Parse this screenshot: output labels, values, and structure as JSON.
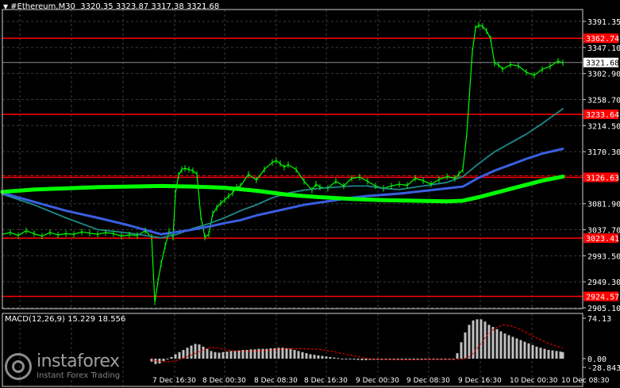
{
  "header": {
    "symbol": "#Ethereum,M30",
    "ohlc": "3320.35 3323.87 3317.38 3321.68"
  },
  "macd_header": "MACD(12,26,9) 15.229 18.556",
  "logo": {
    "name": "instaforex",
    "tagline": "Instant Forex Trading"
  },
  "colors": {
    "background": "#000000",
    "grid": "#3c3c3c",
    "axis": "#ffffff",
    "candles": "#00ff00",
    "level_lines": "#ff0000",
    "ma_fast": "#1d8a8a",
    "ma_mid": "#3a5fe0",
    "ma_slow": "#00ff00",
    "macd_hist": "#c0c0c0",
    "macd_signal": "#ff0000"
  },
  "chart_data": {
    "type": "line",
    "title": "#Ethereum,M30",
    "price_axis": {
      "min": 2905.1,
      "max": 3391.35,
      "ticks": [
        3391.35,
        3347.1,
        3302.9,
        3258.7,
        3214.5,
        3170.3,
        3081.9,
        3037.7,
        2993.5,
        2949.3,
        2905.1
      ]
    },
    "time_labels": [
      "7 Dec 16:30",
      "8 Dec 00:30",
      "8 Dec 08:30",
      "8 Dec 16:30",
      "9 Dec 00:30",
      "9 Dec 08:30",
      "9 Dec 16:30",
      "10 Dec 00:30",
      "10 Dec 08:30"
    ],
    "levels": [
      {
        "value": 3362.74,
        "label": "3362.74"
      },
      {
        "value": 3233.64,
        "label": "3233.64"
      },
      {
        "value": 3126.63,
        "label": "3126.63"
      },
      {
        "value": 3023.41,
        "label": "3023.41"
      },
      {
        "value": 2924.57,
        "label": "2924.57"
      }
    ],
    "current_price": {
      "value": 3321.68,
      "label": "3321.68"
    },
    "series": [
      {
        "name": "price",
        "color": "#00ff00",
        "x": [
          0,
          10,
          20,
          30,
          40,
          50,
          60,
          70,
          80,
          90,
          100,
          110,
          120,
          130,
          140,
          150,
          160,
          170,
          180,
          188,
          192,
          196,
          200,
          205,
          210,
          215,
          218,
          222,
          226,
          230,
          235,
          240,
          245,
          250,
          255,
          260,
          265,
          270,
          275,
          280,
          285,
          290,
          295,
          300,
          310,
          320,
          330,
          340,
          345,
          350,
          355,
          360,
          370,
          380,
          390,
          395,
          400,
          410,
          420,
          430,
          440,
          450,
          460,
          470,
          480,
          490,
          500,
          510,
          520,
          530,
          540,
          550,
          560,
          570,
          575,
          580,
          585,
          588,
          592,
          596,
          600,
          605,
          610,
          615,
          620,
          625,
          630,
          640,
          650,
          660,
          670,
          680,
          690,
          700,
          706
        ],
        "y": [
          3030,
          3033,
          3028,
          3036,
          3031,
          3027,
          3033,
          3029,
          3031,
          3030,
          3034,
          3032,
          3030,
          3033,
          3031,
          3027,
          3029,
          3028,
          3036,
          3025,
          2915,
          2950,
          2980,
          3010,
          3035,
          3025,
          3100,
          3130,
          3140,
          3142,
          3140,
          3138,
          3132,
          3060,
          3025,
          3030,
          3065,
          3075,
          3083,
          3088,
          3095,
          3100,
          3110,
          3112,
          3132,
          3122,
          3140,
          3152,
          3155,
          3150,
          3144,
          3148,
          3140,
          3120,
          3105,
          3115,
          3110,
          3108,
          3120,
          3112,
          3125,
          3127,
          3120,
          3112,
          3108,
          3112,
          3115,
          3113,
          3125,
          3121,
          3115,
          3123,
          3128,
          3125,
          3132,
          3140,
          3200,
          3260,
          3340,
          3380,
          3385,
          3383,
          3375,
          3362,
          3320,
          3318,
          3310,
          3318,
          3316,
          3305,
          3300,
          3310,
          3315,
          3324,
          3321
        ]
      },
      {
        "name": "fast_ma",
        "color": "#1d8a8a",
        "x": [
          0,
          40,
          80,
          120,
          160,
          200,
          220,
          240,
          260,
          280,
          300,
          320,
          340,
          360,
          380,
          400,
          420,
          440,
          460,
          480,
          500,
          520,
          540,
          560,
          580,
          600,
          620,
          640,
          660,
          680,
          706
        ],
        "y": [
          3098,
          3080,
          3058,
          3038,
          3032,
          3024,
          3030,
          3040,
          3048,
          3058,
          3070,
          3080,
          3092,
          3100,
          3105,
          3108,
          3110,
          3112,
          3112,
          3108,
          3106,
          3110,
          3114,
          3118,
          3128,
          3150,
          3170,
          3185,
          3200,
          3218,
          3243
        ]
      },
      {
        "name": "mid_ma",
        "color": "#3a5fe0",
        "x": [
          0,
          40,
          80,
          120,
          160,
          200,
          220,
          240,
          260,
          280,
          300,
          320,
          340,
          360,
          380,
          400,
          420,
          440,
          460,
          480,
          500,
          520,
          540,
          560,
          580,
          600,
          620,
          640,
          660,
          680,
          706
        ],
        "y": [
          3100,
          3085,
          3070,
          3058,
          3045,
          3030,
          3034,
          3038,
          3043,
          3049,
          3054,
          3062,
          3068,
          3074,
          3080,
          3084,
          3088,
          3092,
          3095,
          3097,
          3099,
          3102,
          3105,
          3108,
          3111,
          3126,
          3138,
          3148,
          3158,
          3167,
          3175
        ]
      },
      {
        "name": "slow_ma",
        "color": "#00ff00",
        "x": [
          0,
          40,
          80,
          120,
          160,
          200,
          240,
          280,
          320,
          360,
          400,
          440,
          480,
          520,
          560,
          580,
          600,
          620,
          640,
          660,
          680,
          706
        ],
        "y": [
          3102,
          3106,
          3108,
          3110,
          3111,
          3112,
          3111,
          3109,
          3104,
          3097,
          3093,
          3090,
          3088,
          3087,
          3086,
          3087,
          3093,
          3100,
          3107,
          3114,
          3121,
          3128
        ]
      }
    ],
    "macd": {
      "axis": {
        "max": 74.13,
        "zero": 0.0,
        "min": -28.843,
        "ticks": [
          74.13,
          0.0,
          -28.843
        ]
      },
      "histogram": {
        "x": [
          188,
          193,
          198,
          203,
          208,
          213,
          218,
          223,
          228,
          233,
          238,
          243,
          248,
          253,
          258,
          263,
          268,
          273,
          278,
          283,
          288,
          293,
          298,
          303,
          308,
          313,
          318,
          323,
          328,
          333,
          338,
          343,
          348,
          353,
          358,
          363,
          368,
          373,
          378,
          383,
          388,
          393,
          398,
          403,
          408,
          413,
          418,
          423,
          428,
          433,
          438,
          443,
          448,
          453,
          458,
          463,
          468,
          473,
          478,
          483,
          488,
          493,
          498,
          503,
          508,
          513,
          518,
          523,
          528,
          533,
          538,
          543,
          548,
          553,
          558,
          563,
          568,
          573,
          578,
          583,
          588,
          593,
          598,
          603,
          608,
          613,
          618,
          623,
          628,
          633,
          638,
          643,
          648,
          653,
          658,
          663,
          668,
          673,
          678,
          683,
          688,
          693,
          698,
          703,
          706
        ],
        "values": [
          -10,
          -18,
          -16,
          -8,
          -2,
          3,
          8,
          12,
          16,
          20,
          24,
          27,
          26,
          22,
          18,
          14,
          12,
          11,
          12,
          13,
          14,
          14,
          15,
          16,
          16,
          17,
          17,
          18,
          18,
          18,
          19,
          19,
          20,
          20,
          19,
          18,
          16,
          14,
          12,
          10,
          8,
          7,
          6,
          5,
          4,
          3,
          2,
          1,
          0,
          -1,
          -2,
          -3,
          -4,
          -5,
          -5,
          -4,
          -4,
          -4,
          -4,
          -3,
          -3,
          -3,
          -3,
          -3,
          -3,
          -3,
          -3,
          -3,
          -3,
          -3,
          -3,
          -3,
          -3,
          -3,
          -3,
          -2,
          -2,
          10,
          30,
          48,
          62,
          70,
          72,
          72,
          68,
          62,
          58,
          54,
          50,
          46,
          43,
          40,
          37,
          34,
          31,
          28,
          25,
          22,
          20,
          18,
          16,
          15,
          14,
          13,
          12
        ]
      },
      "signal": {
        "x": [
          188,
          200,
          210,
          220,
          230,
          240,
          250,
          260,
          270,
          280,
          300,
          320,
          340,
          360,
          380,
          400,
          420,
          440,
          460,
          480,
          500,
          520,
          540,
          560,
          570,
          580,
          590,
          600,
          610,
          620,
          630,
          640,
          650,
          660,
          670,
          680,
          690,
          700,
          706
        ],
        "y": [
          -4,
          -10,
          -10,
          -6,
          2,
          8,
          14,
          20,
          20,
          16,
          13,
          14,
          16,
          18,
          18,
          17,
          12,
          6,
          0,
          -3,
          -4,
          -4,
          -3,
          -3,
          -3,
          -2,
          5,
          22,
          42,
          55,
          62,
          60,
          55,
          48,
          40,
          33,
          27,
          22,
          20
        ]
      }
    },
    "xlabel": "",
    "ylabel": ""
  }
}
